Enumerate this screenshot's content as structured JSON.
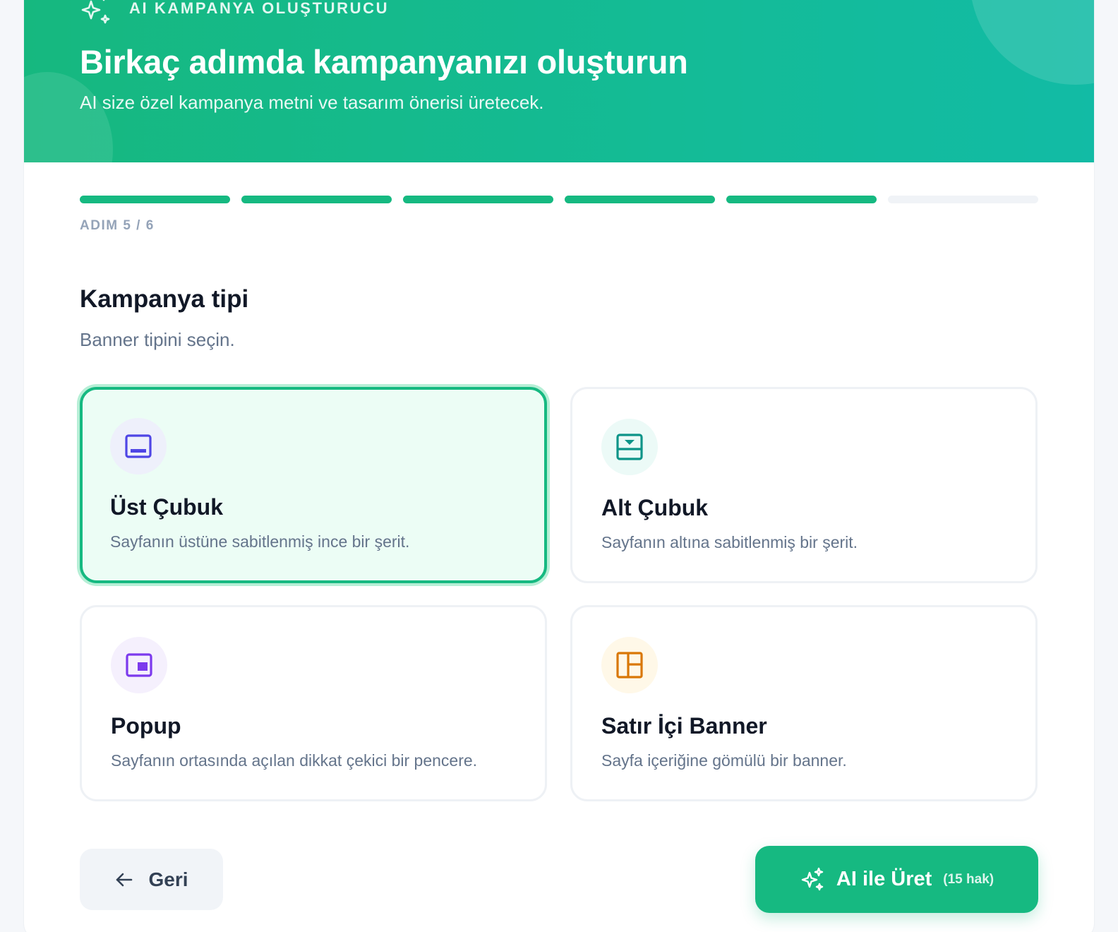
{
  "header": {
    "eyebrow": "AI KAMPANYA OLUŞTURUCU",
    "title": "Birkaç adımda kampanyanızı oluşturun",
    "subtitle": "AI size özel kampanya metni ve tasarım önerisi üretecek."
  },
  "progress": {
    "current": 5,
    "total": 6,
    "label": "ADIM 5 / 6"
  },
  "section": {
    "title": "Kampanya tipi",
    "subtitle": "Banner tipini seçin."
  },
  "options": [
    {
      "title": "Üst Çubuk",
      "description": "Sayfanın üstüne sabitlenmiş ince bir şerit.",
      "icon": "top-bar-icon",
      "icon_color": "#4f46e5",
      "icon_bg": "#eef0fb",
      "selected": true
    },
    {
      "title": "Alt Çubuk",
      "description": "Sayfanın altına sabitlenmiş bir şerit.",
      "icon": "bottom-bar-icon",
      "icon_color": "#0d9488",
      "icon_bg": "#ecfaf7",
      "selected": false
    },
    {
      "title": "Popup",
      "description": "Sayfanın ortasında açılan dikkat çekici bir pencere.",
      "icon": "popup-icon",
      "icon_color": "#7c3aed",
      "icon_bg": "#f5f0fd",
      "selected": false
    },
    {
      "title": "Satır İçi Banner",
      "description": "Sayfa içeriğine gömülü bir banner.",
      "icon": "inline-banner-icon",
      "icon_color": "#d97706",
      "icon_bg": "#fff8e8",
      "selected": false
    }
  ],
  "actions": {
    "back_label": "Geri",
    "generate_label": "AI ile Üret",
    "credits_label": "(15 hak)"
  },
  "colors": {
    "accent": "#16b981",
    "header_gradient_start": "#16b87f",
    "header_gradient_end": "#12bba5"
  }
}
